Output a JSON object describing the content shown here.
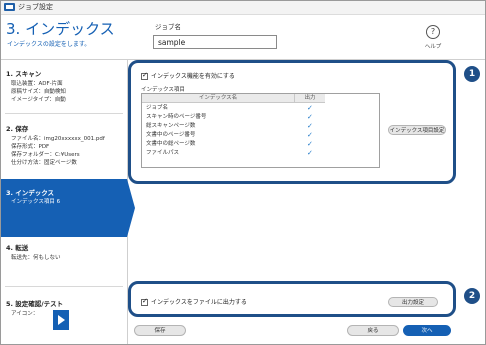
{
  "window": {
    "title": "ジョブ設定"
  },
  "header": {
    "title": "3. インデックス",
    "subtitle": "インデックスの設定をします。",
    "job_name_label": "ジョブ名",
    "job_name_value": "sample",
    "help_label": "ヘルプ"
  },
  "sidebar": {
    "steps": [
      {
        "head": "1. スキャン",
        "lines": [
          "取込装置：ADF-片面",
          "原稿サイズ：自動検知",
          "イメージタイプ：自動"
        ]
      },
      {
        "head": "2. 保存",
        "lines": [
          "ファイル名：img20xxxxxx_001.pdf",
          "保存形式：PDF",
          "保存フォルダー：C:¥Users",
          "仕分け方法：固定ページ数"
        ]
      },
      {
        "head": "3. インデックス",
        "lines": [
          "インデックス項目 6"
        ]
      },
      {
        "head": "4. 転送",
        "lines": [
          "転送先：何もしない"
        ]
      },
      {
        "head": "5. 設定確認/テスト",
        "lines": [
          "アイコン："
        ]
      }
    ]
  },
  "main": {
    "enable_index_label": "インデックス機能を有効にする",
    "enable_index_checked": true,
    "items_label": "インデックス項目",
    "table": {
      "col_name": "インデックス名",
      "col_output": "出力",
      "rows": [
        {
          "name": "ジョブ名",
          "output": "✓"
        },
        {
          "name": "スキャン時のページ番号",
          "output": "✓"
        },
        {
          "name": "総スキャンページ数",
          "output": "✓"
        },
        {
          "name": "文書中のページ番号",
          "output": "✓"
        },
        {
          "name": "文書中の総ページ数",
          "output": "✓"
        },
        {
          "name": "ファイルパス",
          "output": "✓"
        }
      ]
    },
    "index_settings_button": "インデックス項目設定",
    "output_file_label": "インデックスをファイルに出力する",
    "output_file_checked": true,
    "output_settings_button": "出力設定"
  },
  "callouts": [
    "1",
    "2"
  ],
  "footer": {
    "save": "保存",
    "back": "戻る",
    "next": "次へ"
  },
  "colors": {
    "accent": "#1560b4",
    "callout": "#1f4f88"
  }
}
